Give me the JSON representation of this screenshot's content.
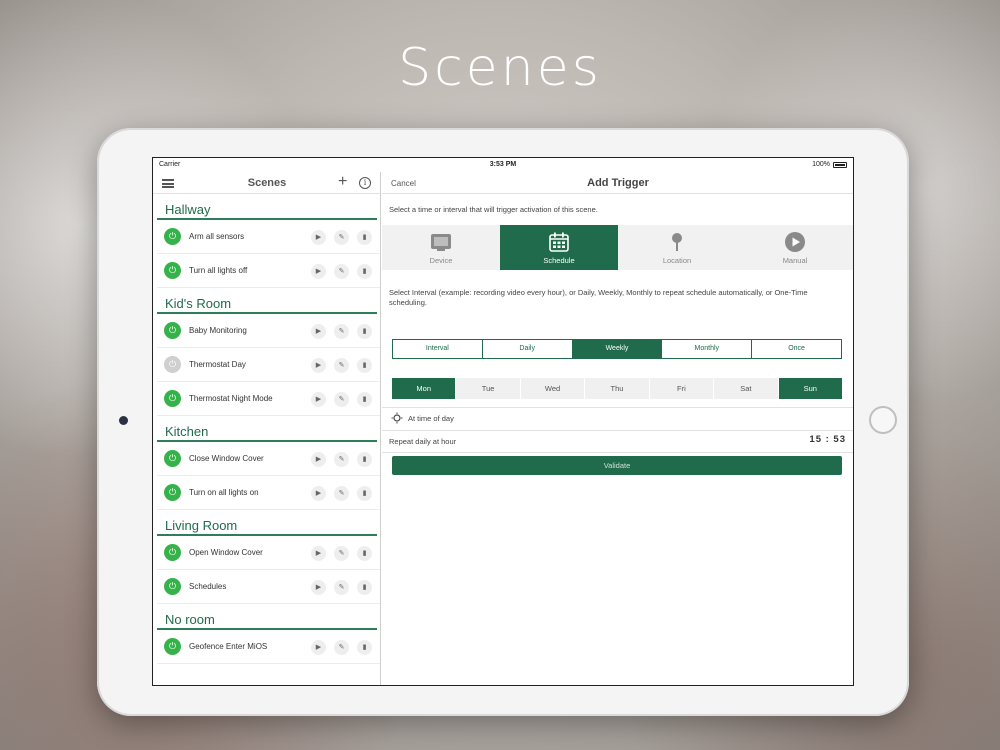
{
  "headline": "Scenes",
  "statusbar": {
    "carrier": "Carrier",
    "time": "3:53 PM",
    "battery": "100%"
  },
  "left": {
    "title": "Scenes",
    "rooms": [
      {
        "name": "Hallway",
        "scenes": [
          {
            "name": "Arm all sensors",
            "enabled": true
          },
          {
            "name": "Turn all lights off",
            "enabled": true
          }
        ]
      },
      {
        "name": "Kid's Room",
        "scenes": [
          {
            "name": "Baby Monitoring",
            "enabled": true
          },
          {
            "name": "Thermostat Day",
            "enabled": false
          },
          {
            "name": "Thermostat Night Mode",
            "enabled": true
          }
        ]
      },
      {
        "name": "Kitchen",
        "scenes": [
          {
            "name": "Close Window Cover",
            "enabled": true
          },
          {
            "name": "Turn on all lights on",
            "enabled": true
          }
        ]
      },
      {
        "name": "Living Room",
        "scenes": [
          {
            "name": "Open Window Cover",
            "enabled": true
          },
          {
            "name": "Schedules",
            "enabled": true
          }
        ]
      },
      {
        "name": "No room",
        "scenes": [
          {
            "name": "Geofence Enter MiOS",
            "enabled": true
          }
        ]
      }
    ]
  },
  "right": {
    "cancel": "Cancel",
    "title": "Add Trigger",
    "intro": "Select a time or interval that will trigger activation of this scene.",
    "trigger_types": [
      {
        "label": "Device",
        "icon": "device-icon",
        "active": false
      },
      {
        "label": "Schedule",
        "icon": "calendar-icon",
        "active": true
      },
      {
        "label": "Location",
        "icon": "location-pin-icon",
        "active": false
      },
      {
        "label": "Manual",
        "icon": "play-circle-icon",
        "active": false
      }
    ],
    "description": "Select Interval (example: recording video every hour), or Daily, Weekly, Monthly to repeat schedule automatically, or One-Time scheduling.",
    "periods": [
      {
        "label": "Interval",
        "active": false
      },
      {
        "label": "Daily",
        "active": false
      },
      {
        "label": "Weekly",
        "active": true
      },
      {
        "label": "Monthly",
        "active": false
      },
      {
        "label": "Once",
        "active": false
      }
    ],
    "days": [
      {
        "label": "Mon",
        "active": true
      },
      {
        "label": "Tue",
        "active": false
      },
      {
        "label": "Wed",
        "active": false
      },
      {
        "label": "Thu",
        "active": false
      },
      {
        "label": "Fri",
        "active": false
      },
      {
        "label": "Sat",
        "active": false
      },
      {
        "label": "Sun",
        "active": true
      }
    ],
    "time_mode": "At time of day",
    "repeat_label": "Repeat daily at hour",
    "hour": "15 : 53",
    "validate": "Validate"
  },
  "colors": {
    "accent": "#1f6b4b",
    "power_on": "#35b34a",
    "power_off": "#cfcfcf"
  }
}
